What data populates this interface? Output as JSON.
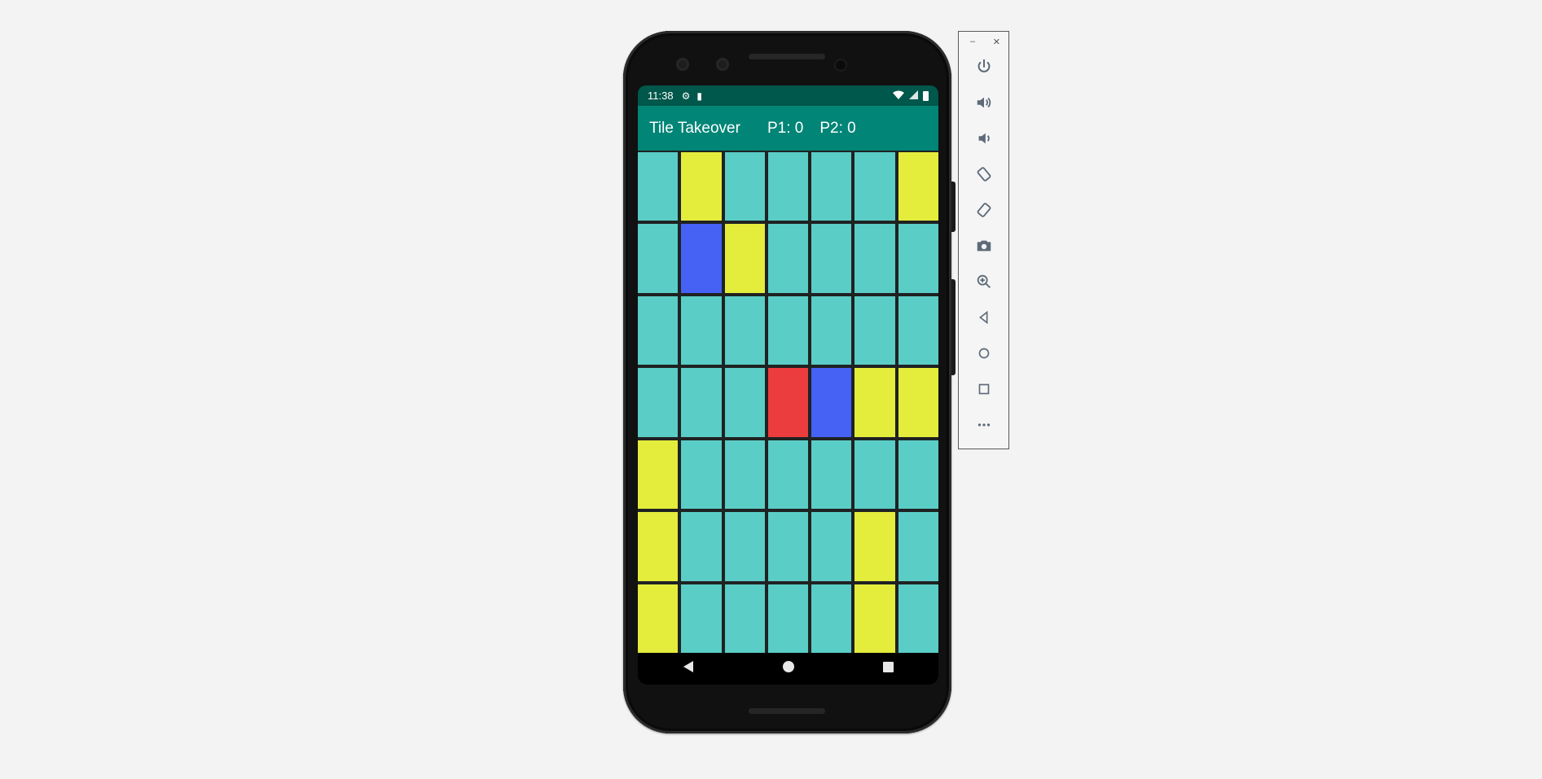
{
  "status_bar": {
    "time": "11:38",
    "icons": [
      "settings-icon",
      "sd-card-icon",
      "wifi-icon",
      "signal-icon",
      "battery-icon"
    ]
  },
  "app_bar": {
    "title": "Tile Takeover",
    "p1_score": "P1: 0",
    "p2_score": "P2: 0"
  },
  "colors": {
    "status_bar": "#00574b",
    "app_bar": "#008577",
    "teal": "#5acdc6",
    "yellow": "#e4ec3c",
    "blue": "#4562f5",
    "red": "#ec3d3e",
    "board_bg": "#1f2222"
  },
  "board": {
    "rows": 7,
    "cols": 7,
    "tiles": [
      [
        "teal",
        "yellow",
        "teal",
        "teal",
        "teal",
        "teal",
        "yellow"
      ],
      [
        "teal",
        "blue",
        "yellow",
        "teal",
        "teal",
        "teal",
        "teal"
      ],
      [
        "teal",
        "teal",
        "teal",
        "teal",
        "teal",
        "teal",
        "teal"
      ],
      [
        "teal",
        "teal",
        "teal",
        "red",
        "blue",
        "yellow",
        "yellow"
      ],
      [
        "yellow",
        "teal",
        "teal",
        "teal",
        "teal",
        "teal",
        "teal"
      ],
      [
        "yellow",
        "teal",
        "teal",
        "teal",
        "teal",
        "yellow",
        "teal"
      ],
      [
        "yellow",
        "teal",
        "teal",
        "teal",
        "teal",
        "yellow",
        "teal"
      ]
    ]
  },
  "nav_bar": [
    "back-icon",
    "home-icon",
    "recents-icon"
  ],
  "emulator_panel": {
    "window_controls": [
      "–",
      "✕"
    ],
    "tools": [
      "power-icon",
      "volume-up-icon",
      "volume-down-icon",
      "rotate-left-icon",
      "rotate-right-icon",
      "camera-icon",
      "zoom-icon",
      "back-icon",
      "home-icon",
      "overview-icon",
      "more-icon"
    ]
  }
}
